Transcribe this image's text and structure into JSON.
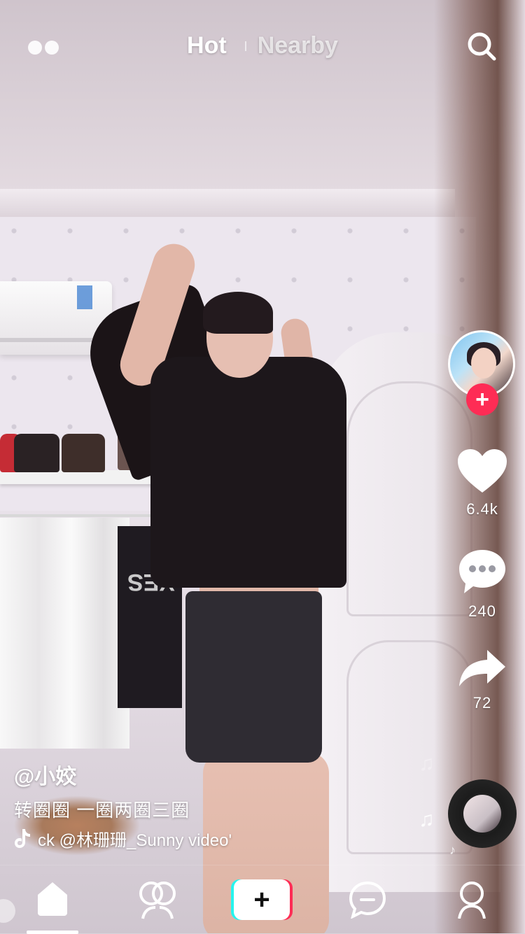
{
  "top_bar": {
    "tabs": [
      {
        "label": "Hot",
        "active": true
      },
      {
        "label": "Nearby",
        "active": false
      }
    ],
    "icons": {
      "left": "live-dots-icon",
      "right": "search-icon"
    }
  },
  "side_rail": {
    "likes": "6.4k",
    "comments": "240",
    "shares": "72",
    "icons": [
      "avatar",
      "follow-plus-icon",
      "heart-icon",
      "comment-icon",
      "share-icon",
      "music-disc"
    ]
  },
  "video_info": {
    "author": "@小姣",
    "caption": "转圈圈 一圈两圈三圈",
    "music_text": "ck    @林珊珊_Sunny video'"
  },
  "tab_bar": {
    "items": [
      "home-icon",
      "discover-icon",
      "add-button",
      "messages-icon",
      "me-icon"
    ],
    "active": "home-icon"
  },
  "colors": {
    "accent_red": "#fe2c55",
    "accent_cyan": "#25f4ee",
    "text": "#ffffff"
  }
}
